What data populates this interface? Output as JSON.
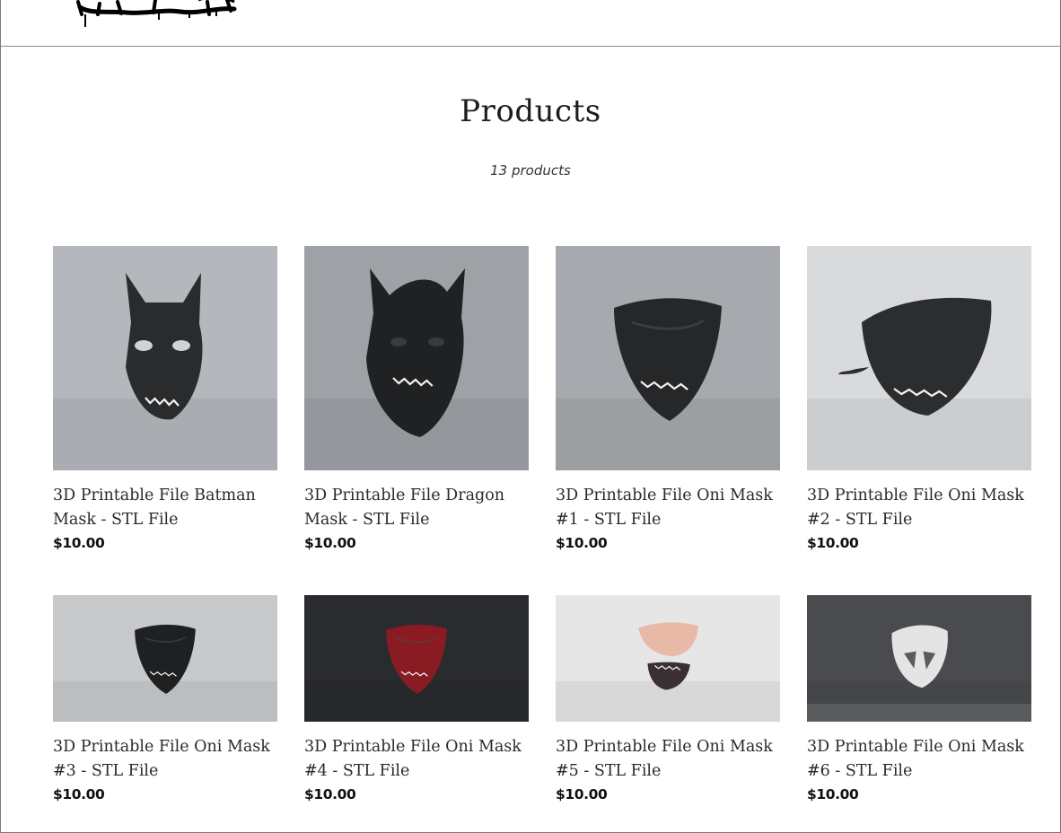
{
  "page": {
    "title": "Products",
    "count_text": "13 products"
  },
  "icons": {
    "logo": "graffiti-logo",
    "product_image": "mask-render-image"
  },
  "colors": {
    "text": "#222222",
    "border": "#7a7a7a"
  },
  "products": [
    {
      "name": "3D Printable File Batman Mask - STL File",
      "price": "$10.00",
      "mask": "batman",
      "background": "#b4b7bb",
      "mask_color": "#2a2b2d"
    },
    {
      "name": "3D Printable File Dragon Mask - STL File",
      "price": "$10.00",
      "mask": "dragon",
      "background": "#9ea2a7",
      "mask_color": "#202122"
    },
    {
      "name": "3D Printable File Oni Mask #1 - STL File",
      "price": "$10.00",
      "mask": "oni-half",
      "background": "#a6a9ad",
      "mask_color": "#262729"
    },
    {
      "name": "3D Printable File Oni Mask #2 - STL File",
      "price": "$10.00",
      "mask": "oni-tusk",
      "background": "#d9dadc",
      "mask_color": "#2c2d2f"
    },
    {
      "name": "3D Printable File Oni Mask #3 - STL File",
      "price": "$10.00",
      "mask": "oni-half",
      "background": "#c8c9cb",
      "mask_color": "#1f2022"
    },
    {
      "name": "3D Printable File Oni Mask #4 - STL File",
      "price": "$10.00",
      "mask": "oni-half",
      "background": "#2a2b2e",
      "mask_color": "#8a1b22"
    },
    {
      "name": "3D Printable File Oni Mask #5 - STL File",
      "price": "$10.00",
      "mask": "oni-split",
      "background": "#e6e6e7",
      "mask_color": "#e9b9a7"
    },
    {
      "name": "3D Printable File Oni Mask #6 - STL File",
      "price": "$10.00",
      "mask": "oni-skull",
      "background": "#4a4b4e",
      "mask_color": "#e4e4e4"
    }
  ]
}
